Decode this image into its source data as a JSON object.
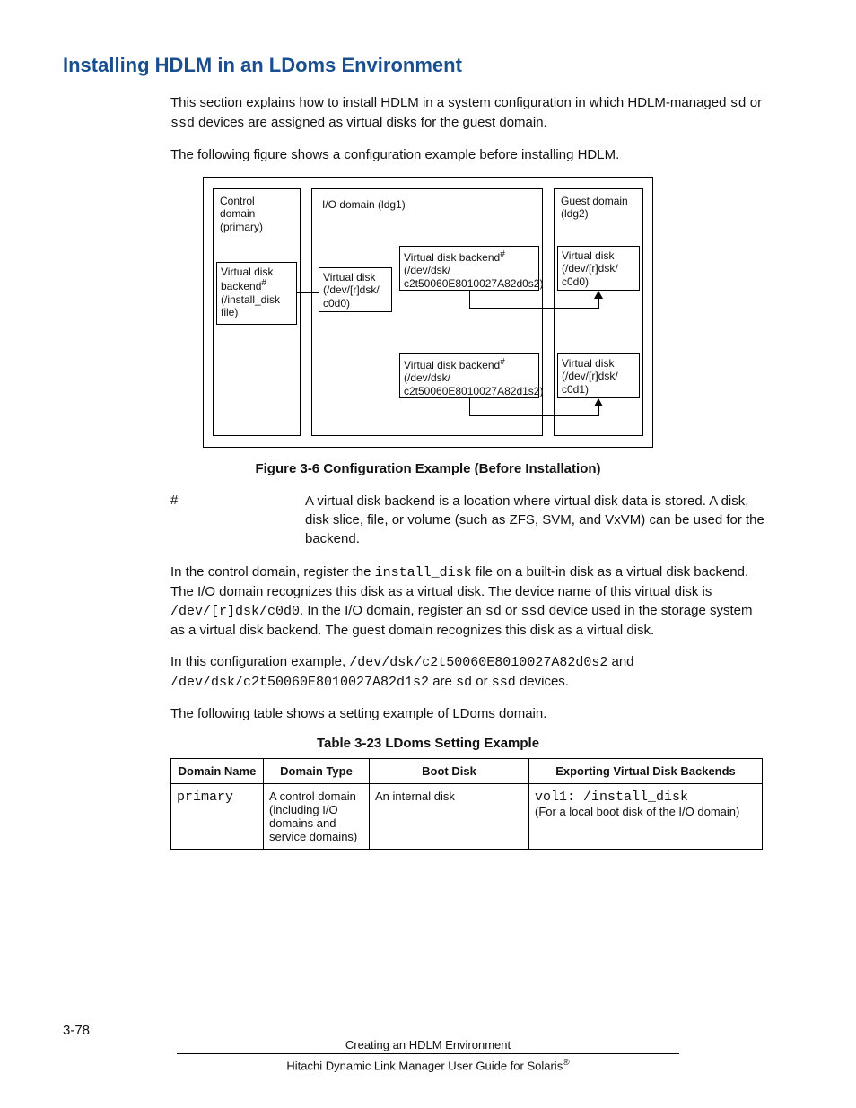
{
  "heading": "Installing HDLM in an LDoms Environment",
  "para1_a": "This section explains how to install HDLM in a system configuration in which HDLM-managed ",
  "para1_b": " or ",
  "para1_c": " devices are assigned as virtual disks for the guest domain.",
  "code_sd": "sd",
  "code_ssd": "ssd",
  "para2": "The following figure shows a configuration example before installing HDLM.",
  "diagram": {
    "control_l1": "Control",
    "control_l2": "domain",
    "control_l3": "(primary)",
    "io_label": "I/O domain (ldg1)",
    "guest_l1": "Guest domain",
    "guest_l2": "(ldg2)",
    "ctrl_box_l1": "Virtual disk",
    "ctrl_box_l2": "backend",
    "ctrl_box_l3": "(/install_disk",
    "ctrl_box_l4": "file)",
    "sup_hash": "#",
    "io_vd_l1": "Virtual disk",
    "io_vd_l2": "(/dev/[r]dsk/",
    "io_vd_l3": "c0d0)",
    "vdb1_l1": "Virtual disk backend",
    "vdb1_l2": "(/dev/dsk/",
    "vdb1_l3": "c2t50060E8010027A82d0s2)",
    "vdb2_l1": "Virtual disk backend",
    "vdb2_l2": "(/dev/dsk/",
    "vdb2_l3": "c2t50060E8010027A82d1s2)",
    "gvd1_l1": "Virtual disk",
    "gvd1_l2": "(/dev/[r]dsk/",
    "gvd1_l3": "c0d0)",
    "gvd2_l1": "Virtual disk",
    "gvd2_l2": "(/dev/[r]dsk/",
    "gvd2_l3": "c0d1)"
  },
  "figure_caption": "Figure 3-6 Configuration Example (Before Installation)",
  "hash": "#",
  "hash_note": "A virtual disk backend is a location where virtual disk data is stored. A disk, disk slice, file, or volume (such as ZFS, SVM, and VxVM) can be used for the backend.",
  "para3_a": "In the control domain, register the ",
  "code_install_disk": "install_disk",
  "para3_b": " file on a built-in disk as a virtual disk backend. The I/O domain recognizes this disk as a virtual disk. The device name of this virtual disk is ",
  "code_dev_c0d0": "/dev/[r]dsk/c0d0",
  "para3_c": ". In the I/O domain, register an ",
  "para3_d": " or ",
  "para3_e": " device used in the storage system as a virtual disk backend. The guest domain recognizes this disk as a virtual disk.",
  "para4_a": "In this configuration example, ",
  "code_p4_1": "/dev/dsk/c2t50060E8010027A82d0s2",
  "para4_b": " and ",
  "code_p4_2": "/dev/dsk/c2t50060E8010027A82d1s2",
  "para4_c": " are ",
  "para4_d": " or ",
  "para4_e": " devices.",
  "para5": "The following table shows a setting example of LDoms domain.",
  "table_caption": "Table 3-23 LDoms Setting Example",
  "table": {
    "h1": "Domain Name",
    "h2": "Domain Type",
    "h3": "Boot Disk",
    "h4": "Exporting Virtual Disk Backends",
    "r1c1": "primary",
    "r1c2": "A control domain (including I/O domains and service domains)",
    "r1c3": "An internal disk",
    "r1c4_code": "vol1: /install_disk",
    "r1c4_text": "(For a local boot disk of the I/O domain)"
  },
  "footer": {
    "pageno": "3-78",
    "line1": "Creating an HDLM Environment",
    "line2_a": "Hitachi Dynamic Link Manager User Guide for Solaris",
    "line2_reg": "®"
  }
}
